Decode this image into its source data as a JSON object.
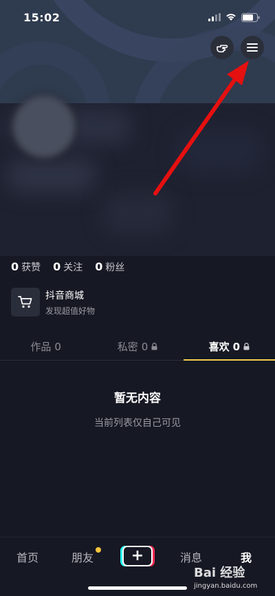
{
  "status": {
    "time": "15:02"
  },
  "stats": [
    {
      "value": "0",
      "label": "获赞"
    },
    {
      "value": "0",
      "label": "关注"
    },
    {
      "value": "0",
      "label": "粉丝"
    }
  ],
  "shop": {
    "title": "抖音商城",
    "subtitle": "发现超值好物"
  },
  "tabs": [
    {
      "label": "作品",
      "count": "0"
    },
    {
      "label": "私密",
      "count": "0"
    },
    {
      "label": "喜欢",
      "count": "0"
    }
  ],
  "empty": {
    "title": "暂无内容",
    "subtitle": "当前列表仅自己可见"
  },
  "nav": {
    "home": "首页",
    "friends": "朋友",
    "plus": "+",
    "messages": "消息",
    "me": "我"
  },
  "watermark": {
    "brand": "Bai 经验",
    "url": "jingyan.baidu.com"
  },
  "colors": {
    "accent": "#f1cd51",
    "background": "#161823",
    "arrow": "#e51010"
  }
}
